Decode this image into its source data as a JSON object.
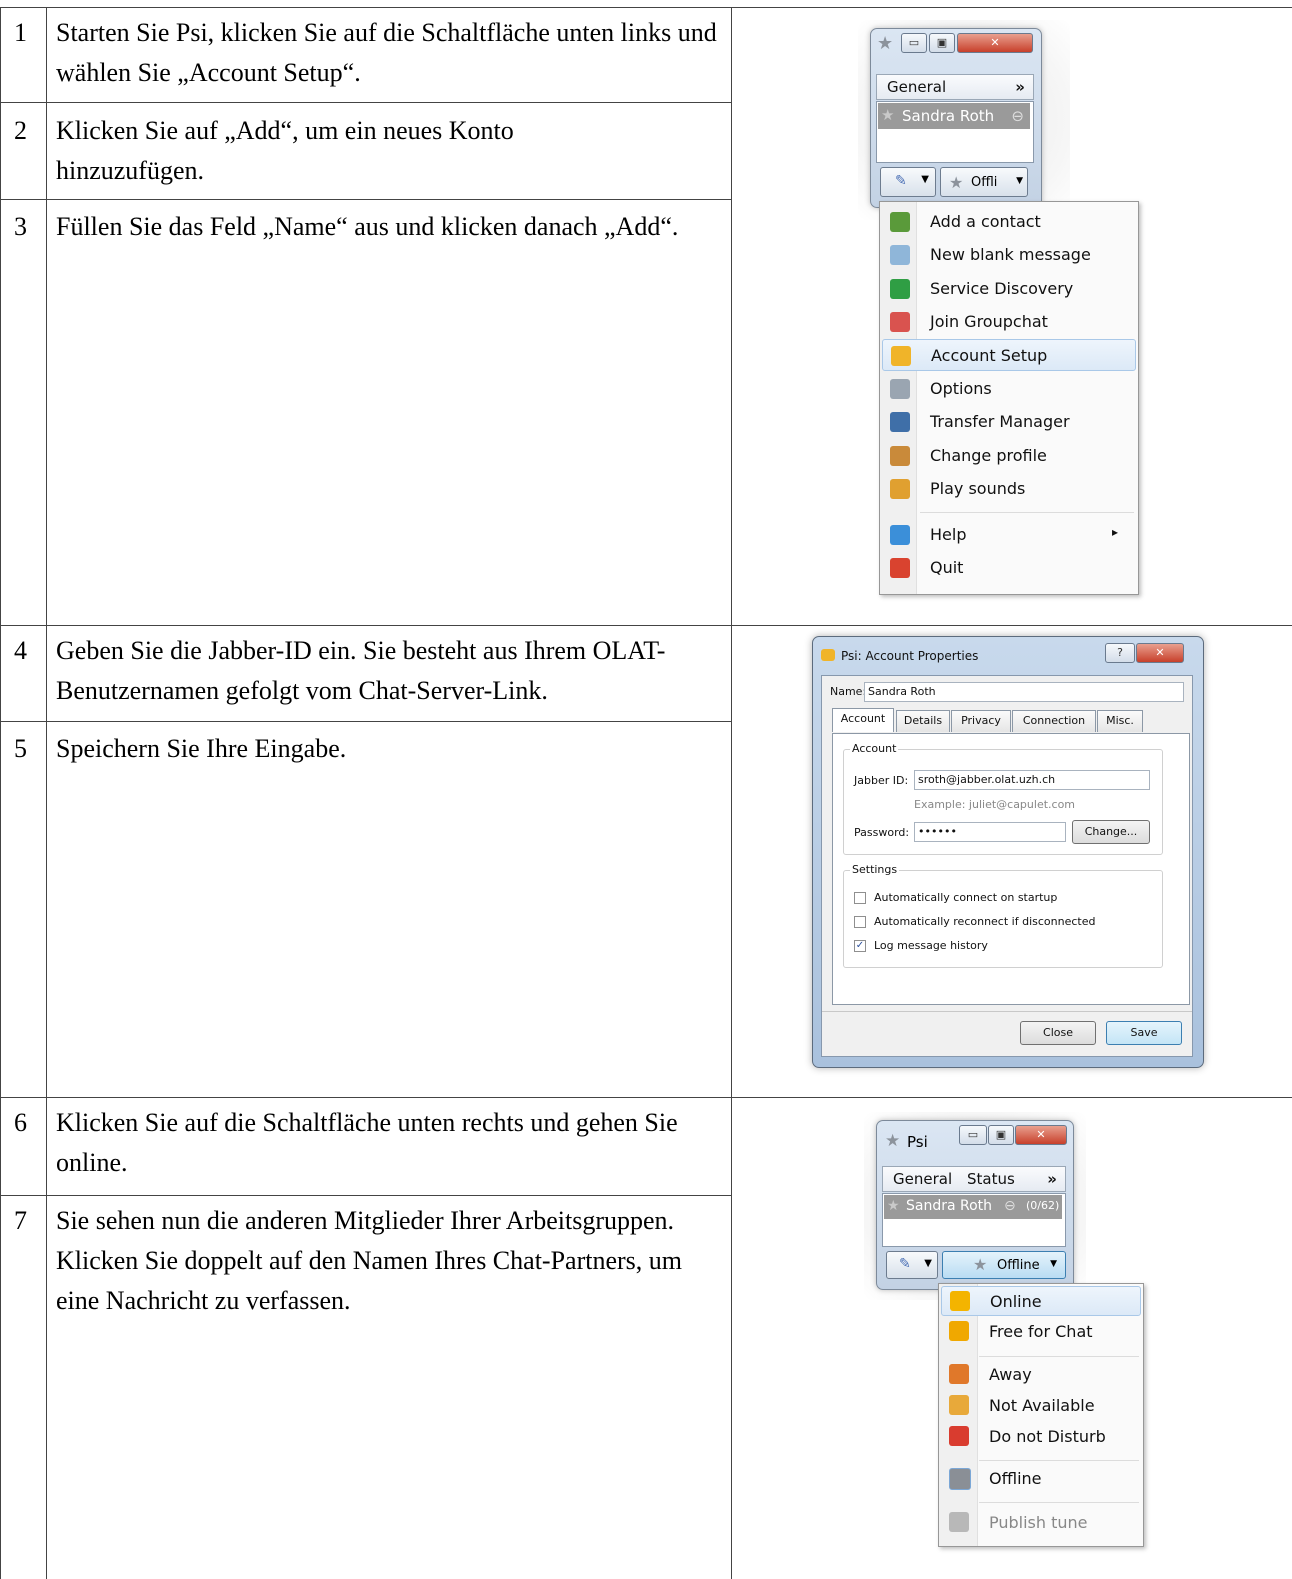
{
  "steps": [
    {
      "num": "1",
      "text": "Starten Sie Psi, klicken Sie auf die Schaltfläche unten links und wählen Sie „Account Setup“."
    },
    {
      "num": "2",
      "text": "Klicken Sie auf „Add“, um ein neues Konto hinzuzufügen."
    },
    {
      "num": "3",
      "text": "Füllen Sie das Feld „Name“ aus und klicken danach „Add“."
    },
    {
      "num": "4",
      "text": "Geben Sie die Jabber-ID ein. Sie besteht aus Ihrem OLAT-Benutzernamen gefolgt vom Chat-Server-Link."
    },
    {
      "num": "5",
      "text": "Speichern Sie Ihre Eingabe."
    },
    {
      "num": "6",
      "text": "Klicken Sie auf die Schaltfläche unten rechts und gehen Sie online."
    },
    {
      "num": "7",
      "text": "Sie sehen nun die anderen Mitglieder Ihrer Arbeitsgruppen. Klicken Sie doppelt auf den Namen Ihres Chat-Partners, um eine Nachricht zu verfassen."
    }
  ],
  "shot1": {
    "title_buttons": [
      "▭",
      "▣",
      "✕"
    ],
    "tab_label": "General",
    "tab_more": "»",
    "contact_name": "Sandra Roth",
    "status_button": "Offli",
    "menu": [
      {
        "label": "Add a contact",
        "icon": "add-contact-icon",
        "color": "#5a9a3a"
      },
      {
        "label": "New blank message",
        "icon": "envelope-icon",
        "color": "#8fb6d9"
      },
      {
        "label": "Service Discovery",
        "icon": "service-discovery-icon",
        "color": "#2f9e44"
      },
      {
        "label": "Join Groupchat",
        "icon": "groupchat-icon",
        "color": "#d9534f"
      },
      {
        "label": "Account Setup",
        "icon": "account-setup-icon",
        "color": "#f0b429"
      },
      {
        "label": "Options",
        "icon": "wrench-icon",
        "color": "#9aa5b1"
      },
      {
        "label": "Transfer Manager",
        "icon": "floppy-icon",
        "color": "#3f6fa8"
      },
      {
        "label": "Change profile",
        "icon": "profile-icon",
        "color": "#c98a3a"
      },
      {
        "label": "Play sounds",
        "icon": "sound-icon",
        "color": "#e0a030"
      },
      {
        "label": "Help",
        "icon": "help-icon",
        "color": "#3b8fd9"
      },
      {
        "label": "Quit",
        "icon": "quit-icon",
        "color": "#d9432f"
      }
    ],
    "help_arrow": "▸"
  },
  "shot2": {
    "title": "Psi: Account Properties",
    "help_btn": "?",
    "close_btn": "✕",
    "name_label": "Name:",
    "name_value": "Sandra Roth",
    "tabs": [
      "Account",
      "Details",
      "Privacy",
      "Connection",
      "Misc."
    ],
    "account_group": "Account",
    "jid_label": "Jabber ID:",
    "jid_value": "sroth@jabber.olat.uzh.ch",
    "jid_example": "Example: juliet@capulet.com",
    "password_label": "Password:",
    "password_value": "••••••",
    "change_button": "Change...",
    "settings_group": "Settings",
    "options": [
      {
        "label": "Automatically connect on startup",
        "checked": false
      },
      {
        "label": "Automatically reconnect if disconnected",
        "checked": false
      },
      {
        "label": "Log message history",
        "checked": true
      }
    ],
    "checkmark": "✓",
    "close_button": "Close",
    "save_button": "Save"
  },
  "shot3": {
    "title": "Psi",
    "title_buttons": [
      "▭",
      "▣",
      "✕"
    ],
    "tab_general": "General",
    "tab_status": "Status",
    "tab_more": "»",
    "contact_name": "Sandra Roth",
    "contact_count": "(0/62)",
    "status_button": "Offline",
    "menu": [
      {
        "label": "Online",
        "icon": "online-star-icon",
        "color": "#f4b400"
      },
      {
        "label": "Free for Chat",
        "icon": "free-chat-star-icon",
        "color": "#f0a800"
      },
      {
        "label": "Away",
        "icon": "away-star-icon",
        "color": "#e0782a"
      },
      {
        "label": "Not Available",
        "icon": "not-available-star-icon",
        "color": "#e8a93a"
      },
      {
        "label": "Do not Disturb",
        "icon": "dnd-star-icon",
        "color": "#d93c2f"
      },
      {
        "label": "Offline",
        "icon": "offline-star-icon",
        "color": "#8a8f96"
      },
      {
        "label": "Publish tune",
        "icon": "publish-tune-icon",
        "color": "#b8b8b8"
      }
    ]
  }
}
